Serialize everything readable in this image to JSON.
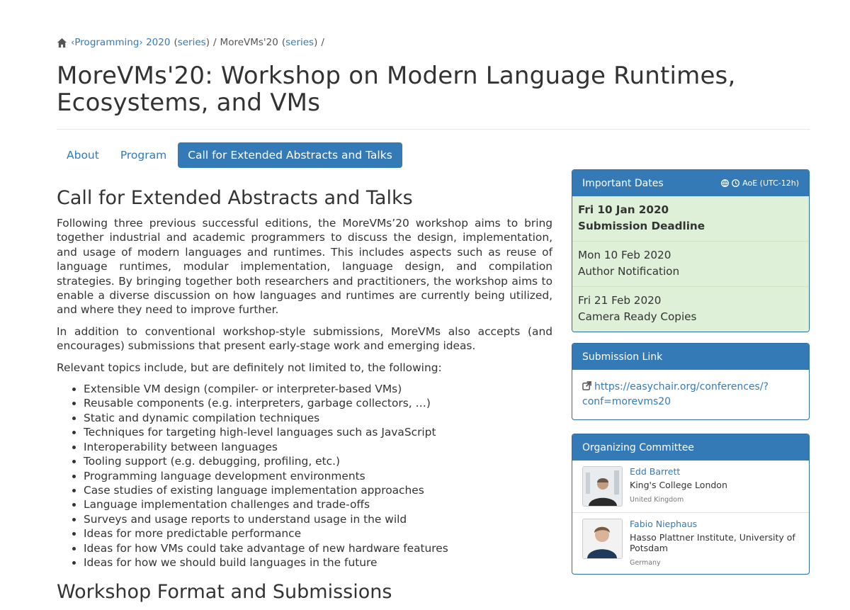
{
  "breadcrumb": {
    "programming": "‹Programming› 2020",
    "series1": "series",
    "moreVms": "MoreVMs'20",
    "series2": "series"
  },
  "page_title": "MoreVMs'20: Workshop on Modern Language Runtimes, Ecosystems, and VMs",
  "tabs": [
    {
      "label": "About"
    },
    {
      "label": "Program"
    },
    {
      "label": "Call for Extended Abstracts and Talks"
    }
  ],
  "main": {
    "heading": "Call for Extended Abstracts and Talks",
    "paragraphs": [
      "Following three previous successful editions, the MoreVMs’20 workshop aims to bring together industrial and academic programmers to discuss the design, implementation, and usage of modern languages and runtimes. This includes aspects such as reuse of language runtimes, modular implementation, language design, and compilation strategies. By bringing together both researchers and practitioners, the workshop aims to enable a diverse discussion on how languages and runtimes are currently being utilized, and where they need to improve further.",
      "In addition to conventional workshop-style submissions, MoreVMs also accepts (and encourages) submissions that present early-stage work and emerging ideas.",
      "Relevant topics include, but are definitely not limited to, the following:"
    ],
    "topics": [
      "Extensible VM design (compiler- or interpreter-based VMs)",
      "Reusable components (e.g. interpreters, garbage collectors, …)",
      "Static and dynamic compilation techniques",
      "Techniques for targeting high-level languages such as JavaScript",
      "Interoperability between languages",
      "Tooling support (e.g. debugging, profiling, etc.)",
      "Programming language development environments",
      "Case studies of existing language implementation approaches",
      "Language implementation challenges and trade-offs",
      "Surveys and usage reports to understand usage in the wild",
      "Ideas for more predictable performance",
      "Ideas for how VMs could take advantage of new hardware features",
      "Ideas for how we should build languages in the future"
    ],
    "next_heading": "Workshop Format and Submissions"
  },
  "important_dates": {
    "title": "Important Dates",
    "timezone": "AoE (UTC-12h)",
    "items": [
      {
        "date": "Fri 10 Jan 2020",
        "label": "Submission Deadline"
      },
      {
        "date": "Mon 10 Feb 2020",
        "label": "Author Notification"
      },
      {
        "date": "Fri 21 Feb 2020",
        "label": "Camera Ready Copies"
      }
    ]
  },
  "submission": {
    "title": "Submission Link",
    "url_line1": "https://easychair.org/conferences/?",
    "url_line2": "conf=morevms20"
  },
  "committee": {
    "title": "Organizing Committee",
    "members": [
      {
        "name": "Edd Barrett",
        "affiliation": "King's College London",
        "country": "United Kingdom"
      },
      {
        "name": "Fabio Niephaus",
        "affiliation": "Hasso Plattner Institute, University of Potsdam",
        "country": "Germany"
      }
    ]
  },
  "colors": {
    "primary": "#337ab7",
    "dates_bg": "#dff0d8"
  }
}
